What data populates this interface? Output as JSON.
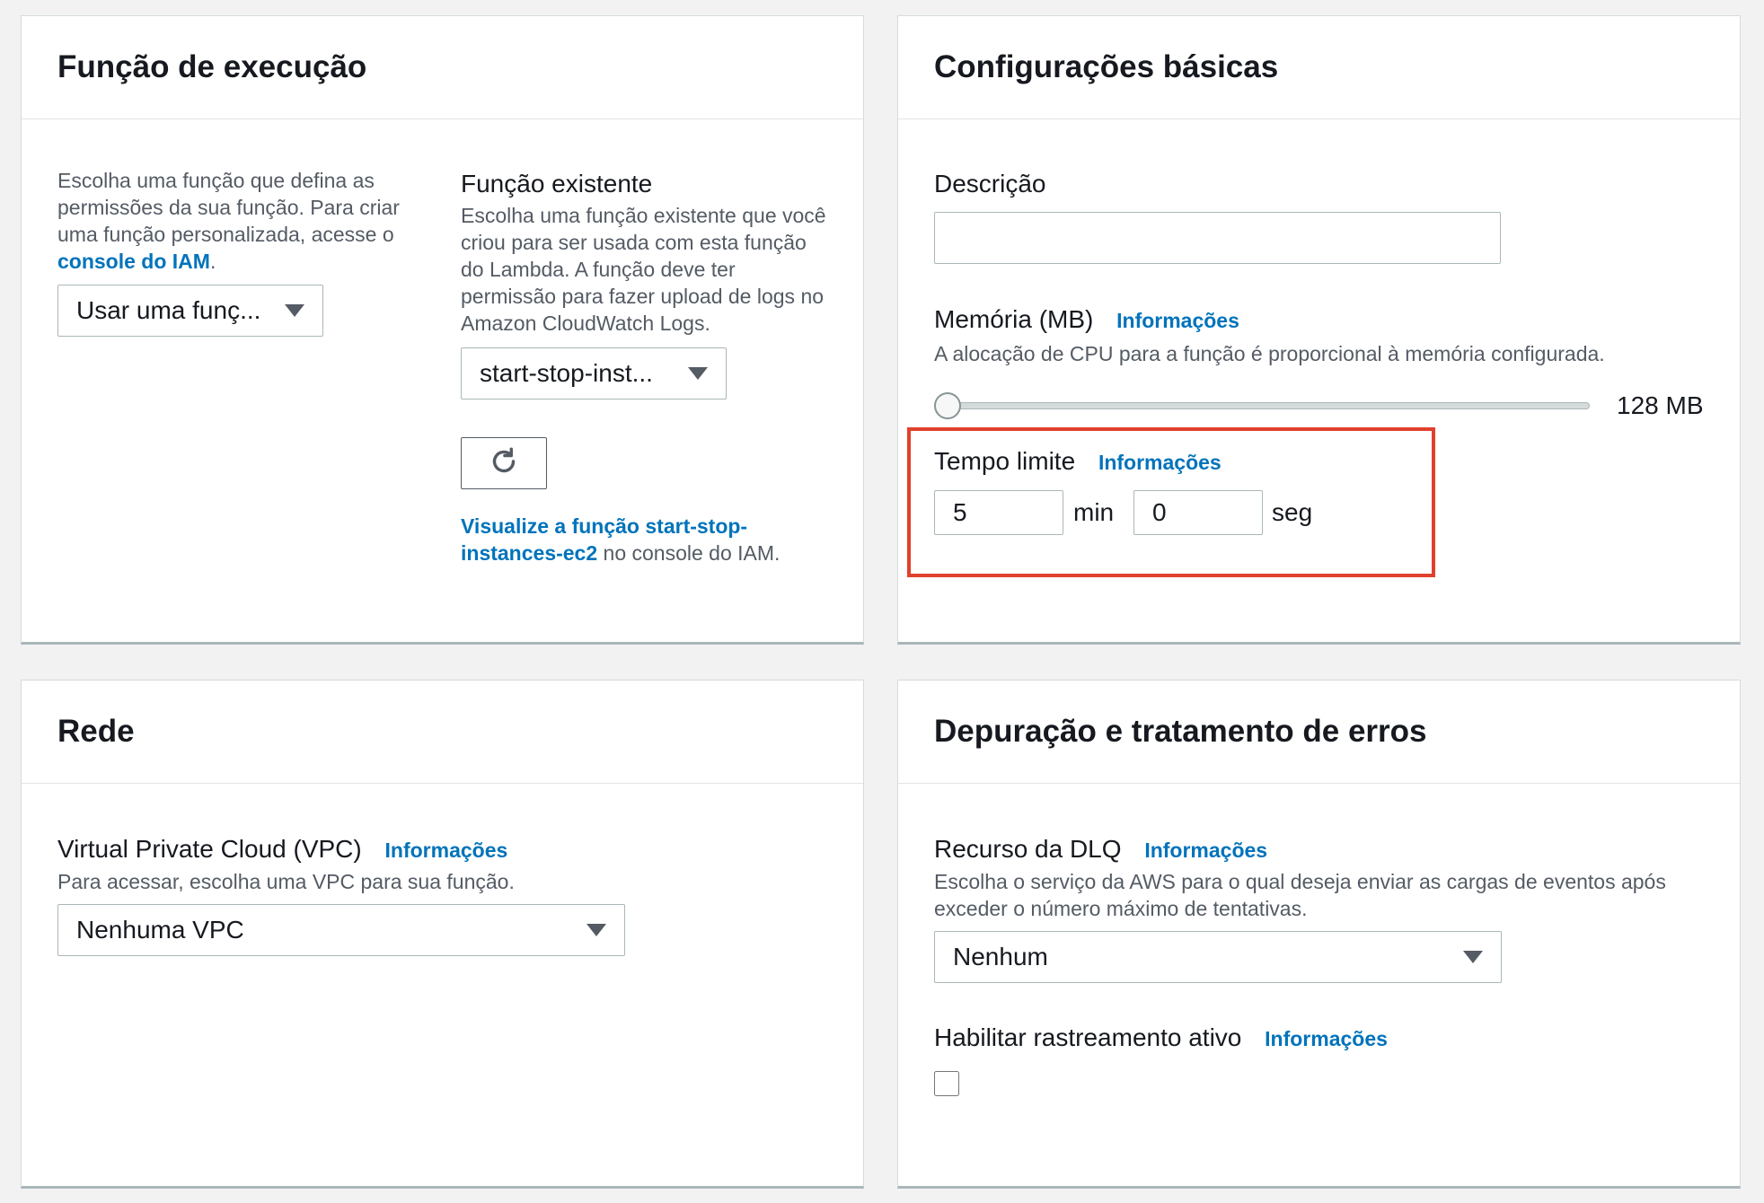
{
  "execution_role": {
    "title": "Função de execução",
    "desc_text": "Escolha uma função que defina as permissões da sua função. Para criar uma função personalizada, acesse o",
    "desc_link": "console do IAM",
    "desc_end": ".",
    "role_select_value": "Usar uma funç...",
    "existing_label": "Função existente",
    "existing_desc": "Escolha uma função existente que você criou para ser usada com esta função do Lambda. A função deve ter permissão para fazer upload de logs no Amazon CloudWatch Logs.",
    "existing_select_value": "start-stop-inst...",
    "view_link": "Visualize a função start-stop-instances-ec2",
    "view_suffix": " no console do IAM."
  },
  "basic_settings": {
    "title": "Configurações básicas",
    "description_label": "Descrição",
    "description_value": "",
    "memory_label": "Memória (MB)",
    "memory_info": "Informações",
    "memory_desc": "A alocação de CPU para a função é proporcional à memória configurada.",
    "memory_value_label": "128 MB",
    "memory_slider_fraction": 0,
    "timeout_label": "Tempo limite",
    "timeout_info": "Informações",
    "timeout_min_value": "5",
    "timeout_min_unit": "min",
    "timeout_sec_value": "0",
    "timeout_sec_unit": "seg",
    "highlight_color": "#e0412c"
  },
  "network": {
    "title": "Rede",
    "vpc_label": "Virtual Private Cloud (VPC)",
    "vpc_info": "Informações",
    "vpc_desc": "Para acessar, escolha uma VPC para sua função.",
    "vpc_select_value": "Nenhuma VPC"
  },
  "debugging": {
    "title": "Depuração e tratamento de erros",
    "dlq_label": "Recurso da DLQ",
    "dlq_info": "Informações",
    "dlq_desc": "Escolha o serviço da AWS para o qual deseja enviar as cargas de eventos após exceder o número máximo de tentativas.",
    "dlq_select_value": "Nenhum",
    "tracing_label": "Habilitar rastreamento ativo",
    "tracing_info": "Informações",
    "tracing_checked": false
  },
  "colors": {
    "link": "#0073bb",
    "text": "#16191f",
    "muted": "#545b64",
    "border": "#aab7b8",
    "background": "#f2f2f2"
  },
  "icons": {
    "refresh": "refresh-icon",
    "dropdown": "caret-down-icon"
  }
}
